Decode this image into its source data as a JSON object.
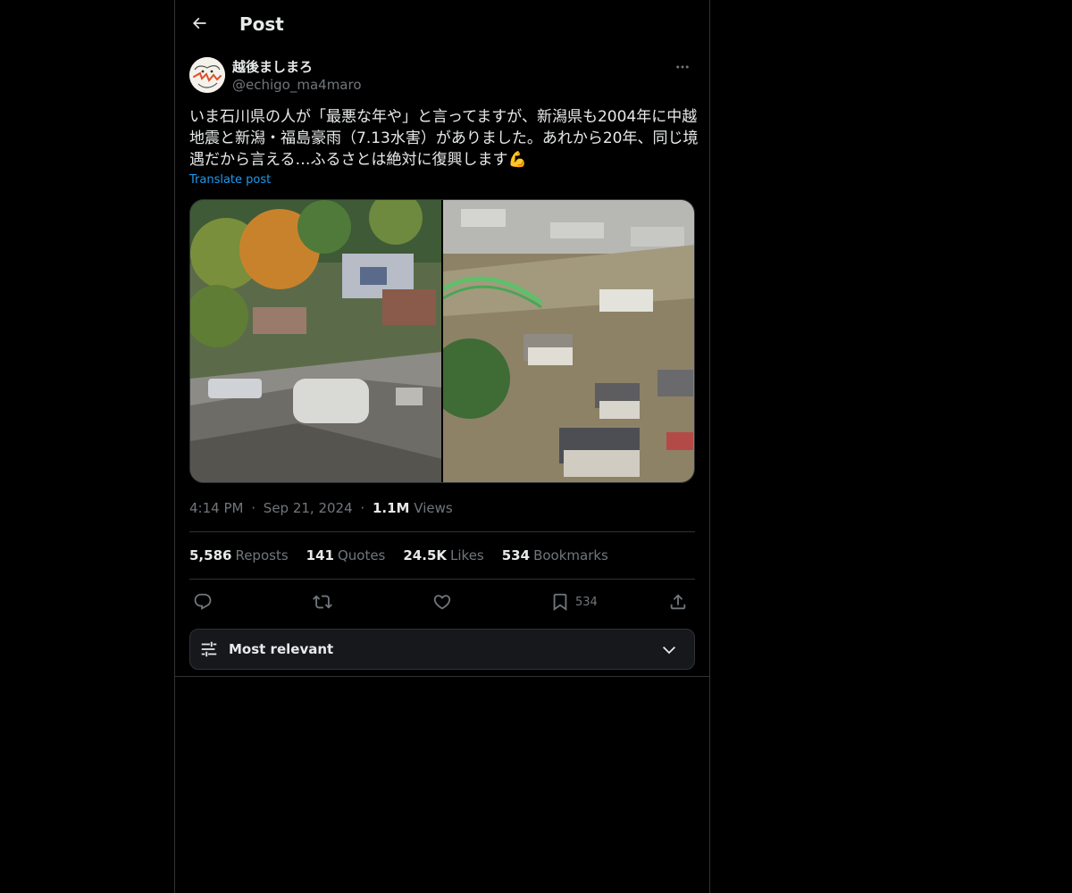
{
  "header": {
    "title": "Post",
    "back_icon": "arrow-left-icon"
  },
  "author": {
    "display_name": "越後ましまろ",
    "handle": "@echigo_ma4maro",
    "more_icon": "more-horizontal-icon"
  },
  "post": {
    "text": "いま石川県の人が「最悪な年や」と言ってますが、新潟県も2004年に中越地震と新潟・福島豪雨（7.13水害）がありました。あれから20年、同じ境遇だから言える…ふるさとは絶対に復興します💪",
    "translate_label": "Translate post",
    "time": "4:14 PM",
    "date": "Sep 21, 2024",
    "views_count": "1.1M",
    "views_label": "Views",
    "dot": "·"
  },
  "stats": {
    "reposts_count": "5,586",
    "reposts_label": "Reposts",
    "quotes_count": "141",
    "quotes_label": "Quotes",
    "likes_count": "24.5K",
    "likes_label": "Likes",
    "bookmarks_count": "534",
    "bookmarks_label": "Bookmarks"
  },
  "actions": {
    "reply_icon": "reply-icon",
    "repost_icon": "repost-icon",
    "like_icon": "heart-icon",
    "bookmark_icon": "bookmark-icon",
    "bookmark_count": "534",
    "share_icon": "share-icon"
  },
  "sort": {
    "label": "Most relevant",
    "icon": "sliders-icon",
    "chevron": "chevron-down-icon"
  },
  "colors": {
    "background": "#000000",
    "border": "#2f3336",
    "text": "#e7e9ea",
    "secondary": "#71767b",
    "accent": "#1d9bf0"
  }
}
